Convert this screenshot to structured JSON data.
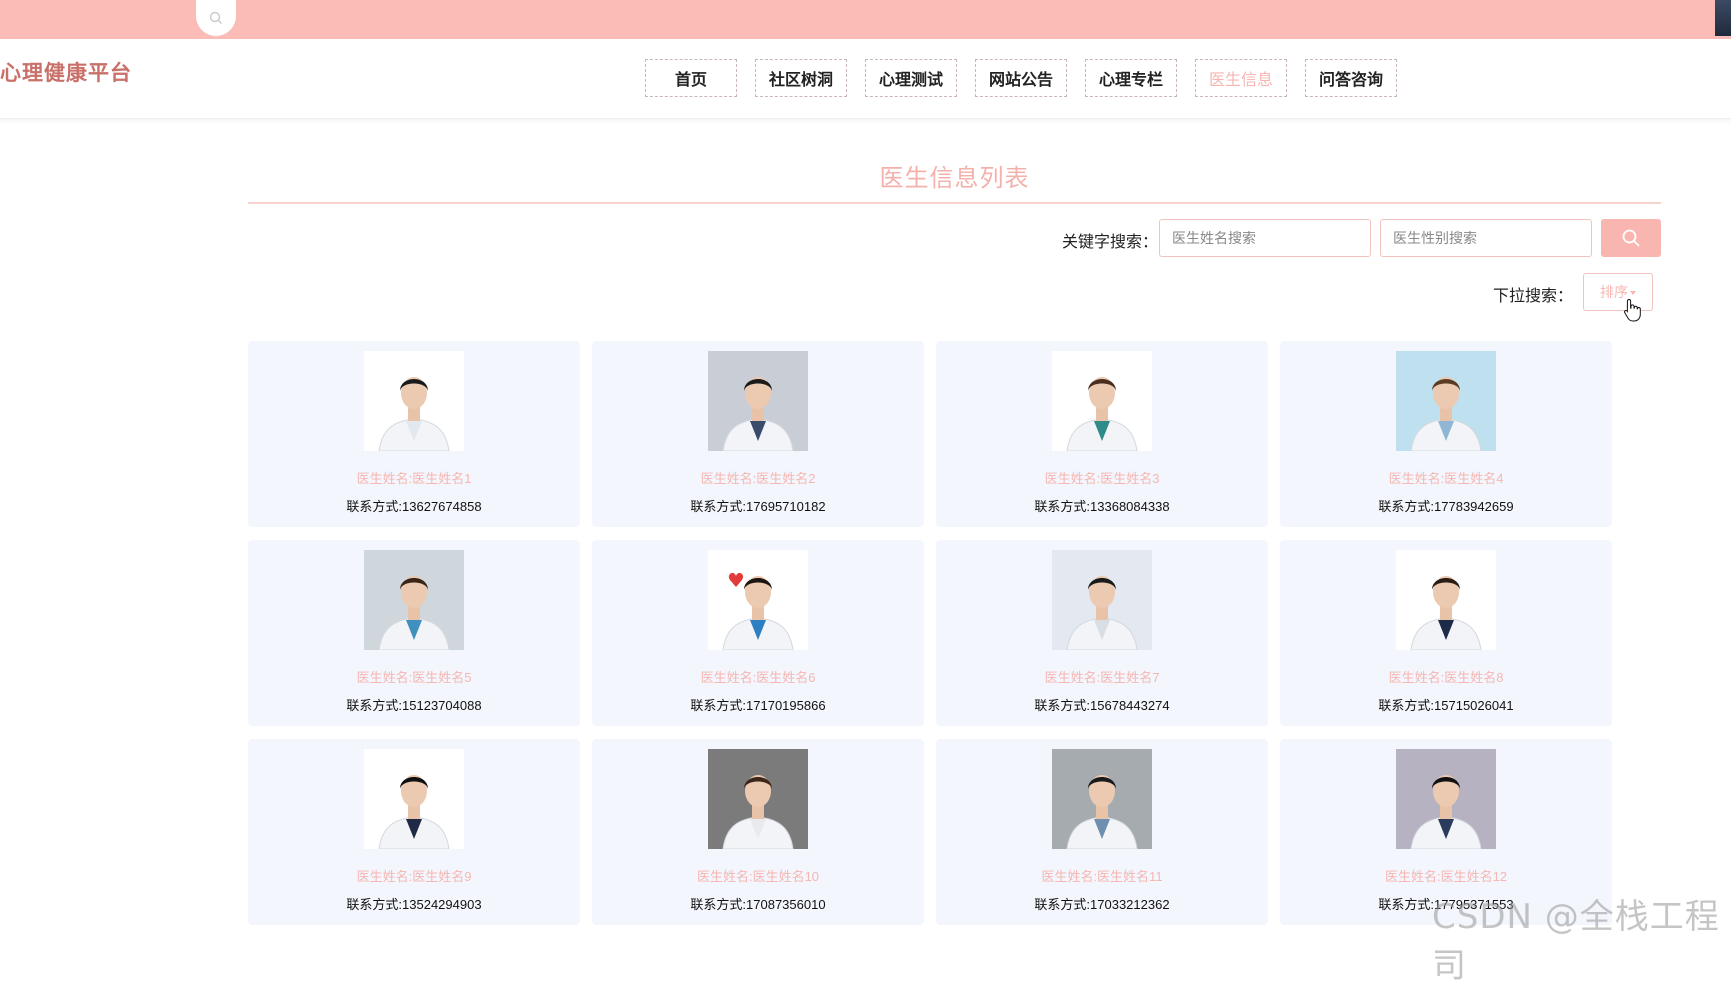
{
  "topbar": {
    "search_icon": "search-icon",
    "bg": "#fbbcb8"
  },
  "header": {
    "logo": "心理健康平台",
    "nav": [
      {
        "label": "首页"
      },
      {
        "label": "社区树洞"
      },
      {
        "label": "心理测试"
      },
      {
        "label": "网站公告"
      },
      {
        "label": "心理专栏"
      },
      {
        "label": "医生信息",
        "active": true
      },
      {
        "label": "问答咨询"
      }
    ]
  },
  "main": {
    "title": "医生信息列表",
    "keyword_label": "关键字搜索：",
    "name_placeholder": "医生姓名搜索",
    "gender_placeholder": "医生性别搜索",
    "dropdown_label": "下拉搜索：",
    "sort_label": "排序",
    "accent": "#f9b6b1",
    "doctors": [
      {
        "name": "医生姓名:医生姓名1",
        "phone": "联系方式:13627674858",
        "bg": "#ffffff"
      },
      {
        "name": "医生姓名:医生姓名2",
        "phone": "联系方式:17695710182",
        "bg": "#c9ced6"
      },
      {
        "name": "医生姓名:医生姓名3",
        "phone": "联系方式:13368084338",
        "bg": "#ffffff"
      },
      {
        "name": "医生姓名:医生姓名4",
        "phone": "联系方式:17783942659",
        "bg": "#bfe0ef"
      },
      {
        "name": "医生姓名:医生姓名5",
        "phone": "联系方式:15123704088",
        "bg": "#cfd6dc"
      },
      {
        "name": "医生姓名:医生姓名6",
        "phone": "联系方式:17170195866",
        "bg": "#ffffff"
      },
      {
        "name": "医生姓名:医生姓名7",
        "phone": "联系方式:15678443274",
        "bg": "#e3e8f1"
      },
      {
        "name": "医生姓名:医生姓名8",
        "phone": "联系方式:15715026041",
        "bg": "#ffffff"
      },
      {
        "name": "医生姓名:医生姓名9",
        "phone": "联系方式:13524294903",
        "bg": "#ffffff"
      },
      {
        "name": "医生姓名:医生姓名10",
        "phone": "联系方式:17087356010",
        "bg": "#7b7b7b"
      },
      {
        "name": "医生姓名:医生姓名11",
        "phone": "联系方式:17033212362",
        "bg": "#a6abb0"
      },
      {
        "name": "医生姓名:医生姓名12",
        "phone": "联系方式:17795371553",
        "bg": "#b6b2c2"
      }
    ]
  },
  "watermark": "CSDN @全栈工程司"
}
